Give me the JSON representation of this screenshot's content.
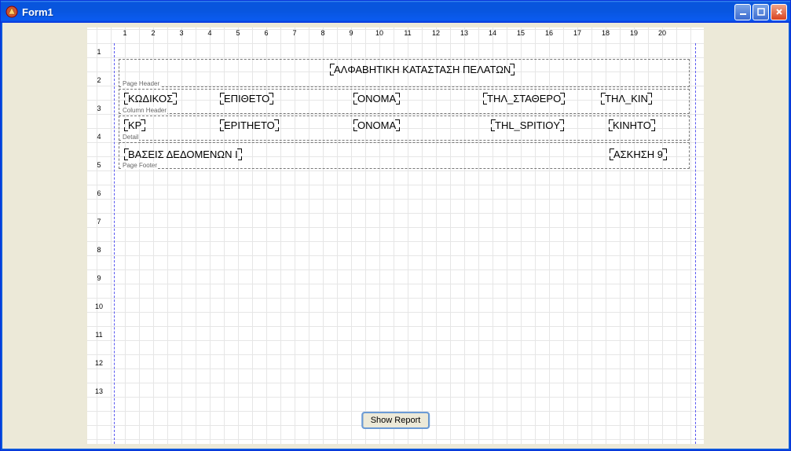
{
  "window": {
    "title": "Form1"
  },
  "ruler_top": [
    "1",
    "2",
    "3",
    "4",
    "5",
    "6",
    "7",
    "8",
    "9",
    "10",
    "11",
    "12",
    "13",
    "14",
    "15",
    "16",
    "17",
    "18",
    "19",
    "20"
  ],
  "ruler_left": [
    "1",
    "2",
    "3",
    "4",
    "5",
    "6",
    "7",
    "8",
    "9",
    "10",
    "11",
    "12",
    "13"
  ],
  "bands": {
    "page_header": {
      "label": "Page Header",
      "title_field": "ΑΛΦΑΒΗΤΙΚΗ ΚΑΤΑΣΤΑΣΗ ΠΕΛΑΤΩΝ"
    },
    "column_header": {
      "label": "Column Header",
      "cols": [
        "ΚΩΔΙΚΟΣ",
        "ΕΠΙΘΕΤΟ",
        "ΟΝΟΜΑ",
        "ΤΗΛ_ΣΤΑΘΕΡΟ",
        "ΤΗΛ_ΚΙΝ"
      ]
    },
    "detail": {
      "label": "Detail",
      "cols": [
        "KP",
        "EPITHETO",
        "ONOMA",
        "THL_SPITIOY",
        "KINHTO"
      ]
    },
    "page_footer": {
      "label": "Page Footer",
      "left_field": "ΒΑΣΕΙΣ ΔΕΔΟΜΕΝΩΝ Ι",
      "right_field": "ΑΣΚΗΣΗ 9"
    }
  },
  "button": {
    "show_report": "Show Report"
  }
}
